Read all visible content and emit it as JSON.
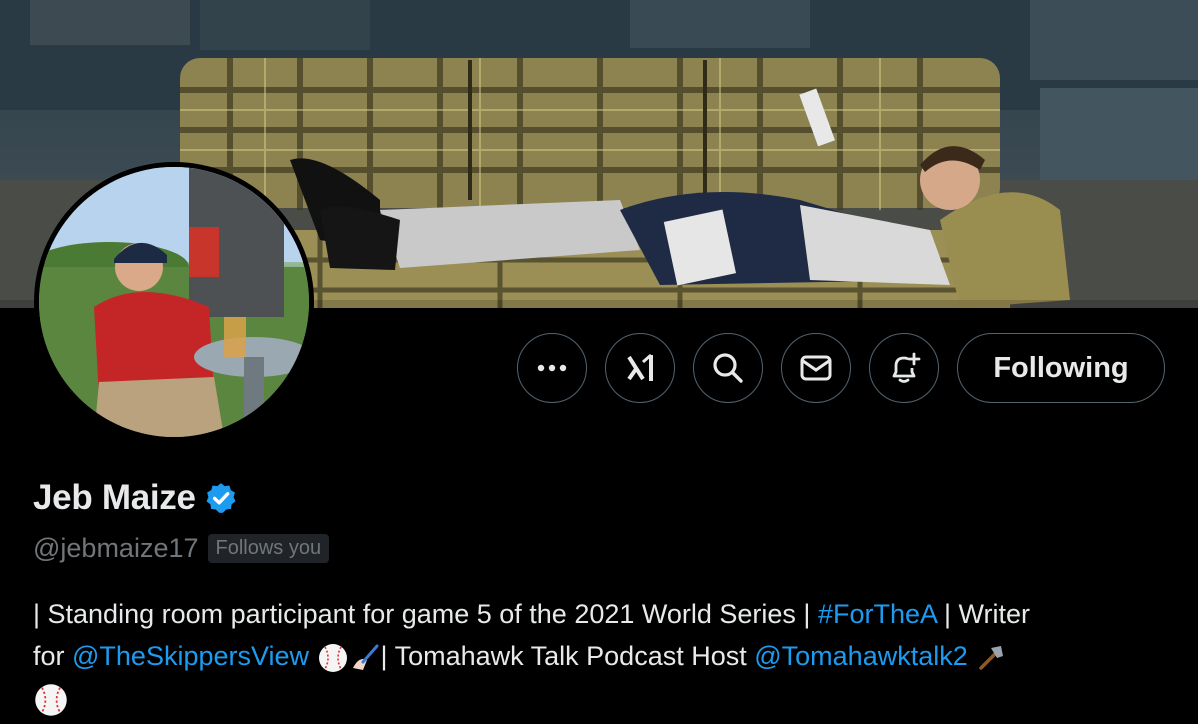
{
  "profile": {
    "display_name": "Jeb Maize",
    "handle": "@jebmaize17",
    "follows_you_badge": "Follows you",
    "verified": true,
    "accent_color": "#1d9bf0"
  },
  "actions": {
    "more_icon": "more-icon",
    "grok_icon": "grok-icon",
    "search_icon": "search-icon",
    "message_icon": "message-icon",
    "notify_icon": "bell-plus-icon",
    "following_label": "Following"
  },
  "bio": {
    "line1_text": "| Standing room participant for game 5 of the 2021 World Series | ",
    "hashtag": "#ForTheA",
    "line1_tail": " | Writer",
    "line2_prefix": "for ",
    "mention1": "@TheSkippersView",
    "line2_mid": "| Tomahawk Talk Podcast Host ",
    "mention2": "@Tomahawktalk2"
  }
}
